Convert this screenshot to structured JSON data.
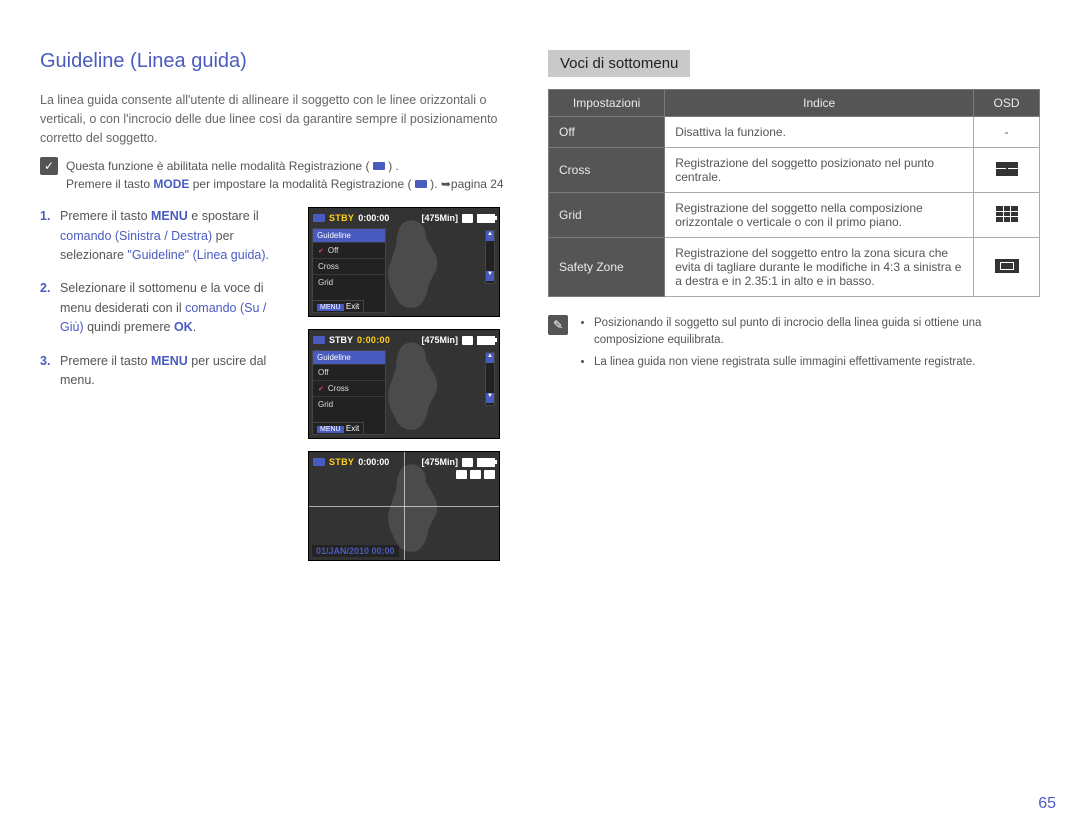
{
  "heading": "Guideline (Linea guida)",
  "intro": "La linea guida consente all'utente di allineare il soggetto con le linee orizzontali o verticali, o con l'incrocio delle due linee così da garantire sempre il posizionamento corretto del soggetto.",
  "precheck": {
    "line1": "Questa funzione è abilitata nelle modalità Registrazione (",
    "line2": ") .",
    "line3_a": "Premere il tasto ",
    "line3_b": "MODE",
    "line3_c": " per impostare la modalità Registrazione ( ",
    "line3_d": "). ➥pagina 24"
  },
  "steps": {
    "s1_a": "Premere il tasto ",
    "s1_menu": "MENU",
    "s1_b": " e spostare il ",
    "s1_cmd": "comando (Sinistra / Destra)",
    "s1_c": " per selezionare ",
    "s1_q": "\"Guideline\" (Linea guida)",
    "s1_d": ".",
    "s2_a": "Selezionare il sottomenu e la voce di menu desiderati con il ",
    "s2_cmd": "comando (Su / Giù)",
    "s2_b": " quindi premere ",
    "s2_ok": "OK",
    "s2_c": ".",
    "s3_a": "Premere il tasto ",
    "s3_menu": "MENU",
    "s3_b": " per uscire dal menu."
  },
  "lcd": {
    "stby": "STBY",
    "time": "0:00:00",
    "mins": "[475Min]",
    "menu_title": "Guideline",
    "off": "Off",
    "cross": "Cross",
    "grid": "Grid",
    "menu_btn": "MENU",
    "exit": "Exit",
    "datetime": "01/JAN/2010 00:00"
  },
  "right": {
    "title": "Voci di sottomenu",
    "head_set": "Impostazioni",
    "head_idx": "Indice",
    "head_osd": "OSD",
    "rows": [
      {
        "name": "Off",
        "desc": "Disattiva la funzione.",
        "osd": "-"
      },
      {
        "name": "Cross",
        "desc": "Registrazione del soggetto posizionato nel punto centrale.",
        "osd": "cross"
      },
      {
        "name": "Grid",
        "desc": "Registrazione del soggetto nella composizione orizzontale o verticale o con il primo piano.",
        "osd": "grid"
      },
      {
        "name": "Safety Zone",
        "desc": "Registrazione del soggetto entro la zona sicura che evita di tagliare durante le modifiche in 4:3 a sinistra e a destra e in 2.35:1 in alto e in basso.",
        "osd": "safe"
      }
    ],
    "note1": "Posizionando il soggetto sul punto di incrocio della linea guida si ottiene una composizione equilibrata.",
    "note2": "La linea guida non viene registrata sulle immagini effettivamente registrate."
  },
  "page_number": "65"
}
